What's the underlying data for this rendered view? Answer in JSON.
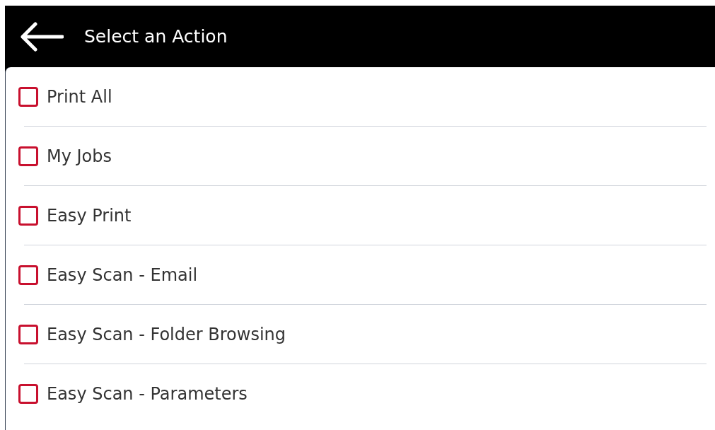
{
  "header": {
    "title": "Select an Action"
  },
  "actions": [
    {
      "label": "Print All",
      "checked": false
    },
    {
      "label": "My Jobs",
      "checked": false
    },
    {
      "label": "Easy Print",
      "checked": false
    },
    {
      "label": "Easy Scan - Email",
      "checked": false
    },
    {
      "label": "Easy Scan - Folder Browsing",
      "checked": false
    },
    {
      "label": "Easy Scan - Parameters",
      "checked": false
    }
  ]
}
